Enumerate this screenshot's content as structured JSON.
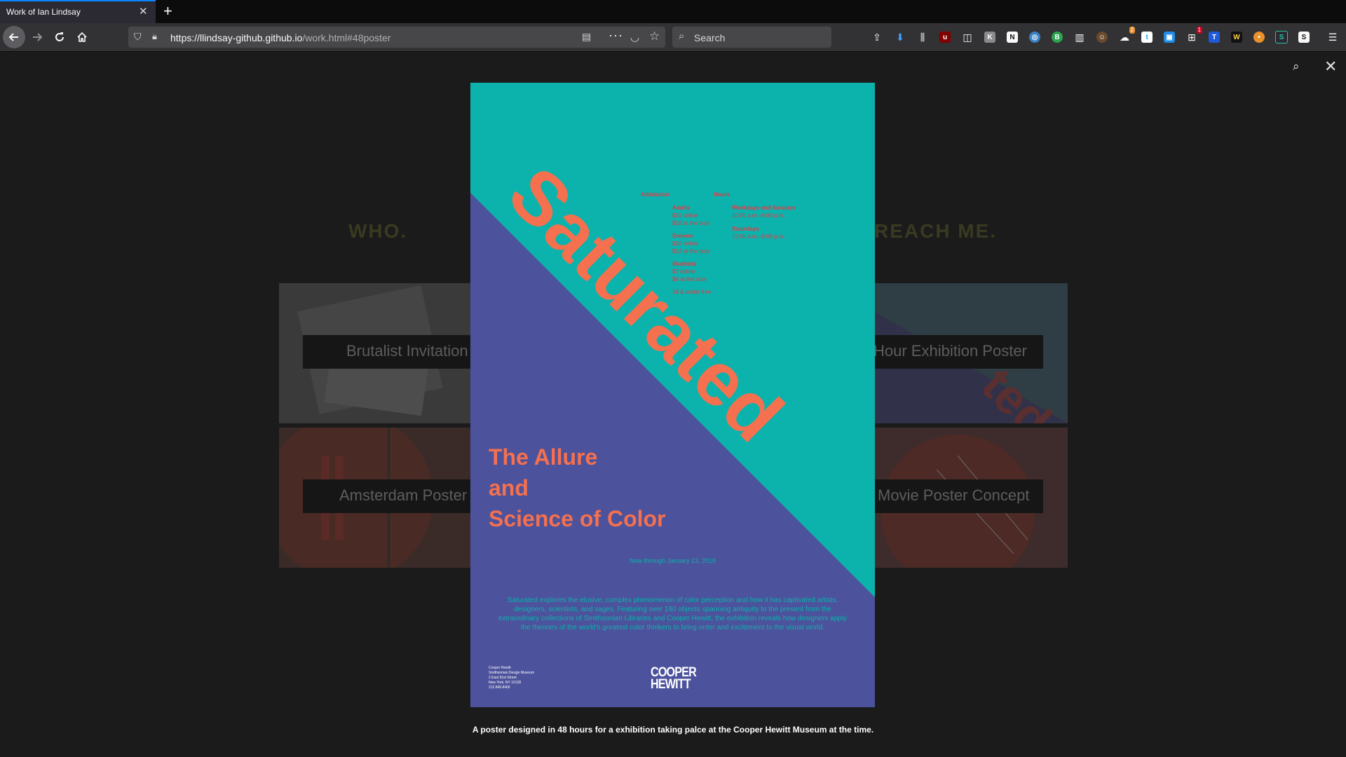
{
  "browser": {
    "tab_title": "Work of Ian Lindsay",
    "tab_close": "✕",
    "new_tab": "+",
    "url_host": "https://llindsay-github.github.io",
    "url_path": "/work.html#48poster",
    "search_placeholder": "Search",
    "toolbar_badges": {
      "extension_a": "2",
      "extension_b": "1"
    }
  },
  "page": {
    "who_heading": "WHO.",
    "reach_heading": "REACH ME.",
    "cards": [
      {
        "label": "Brutalist Invitation"
      },
      {
        "label": "Hour Exhibition Poster"
      },
      {
        "label": "Amsterdam Poster"
      },
      {
        "label": "Movie Poster Concept"
      }
    ]
  },
  "lightbox": {
    "caption": "A poster designed in 48 hours for a exhibition taking palce at the Cooper Hewitt Museum at the time."
  },
  "poster": {
    "colors": {
      "teal": "#0bb3ac",
      "purple": "#4c529c",
      "coral": "#f4704e",
      "red": "#ec3545"
    },
    "title": "Saturated",
    "subtitle_lines": [
      "The Allure",
      "and",
      "Science of Color"
    ],
    "dates": "Now through January 13, 2019",
    "admission_heading": "Admission",
    "hours_heading": "Hours",
    "admission": [
      {
        "label": "Adults",
        "lines": [
          "$16 online",
          "$18 at the door"
        ]
      },
      {
        "label": "Seniors",
        "lines": [
          "$10 online",
          "$12 at the door"
        ]
      },
      {
        "label": "Students",
        "lines": [
          "$7 online",
          "$9 at the door"
        ]
      }
    ],
    "admission_note": "18 & under free",
    "hours": [
      {
        "label": "Weekdays and Sundays",
        "lines": [
          "10:00 a.m.–6:00 p.m."
        ]
      },
      {
        "label": "Saturdays",
        "lines": [
          "10:00 a.m.–9:00 p.m."
        ]
      }
    ],
    "description": "Saturated explores the elusive, complex phenomenon of color perception and how it has captivated artists, designers, scientists, and sages. Featuring over 190 objects spanning antiquity to the present from the extraordinary collections of Smithsonian Libraries and Cooper Hewitt, the exhibition reveals how designers apply the theories of the world's greatest color thinkers to bring order and excitement to the visual world.",
    "address_lines": [
      "Cooper Hewitt",
      "Smithsonian Design Museum",
      "2 East 91st Street",
      "New York, NY 10128",
      "212.849.8400"
    ],
    "logo_lines": [
      "COOPER",
      "HEWITT"
    ]
  }
}
